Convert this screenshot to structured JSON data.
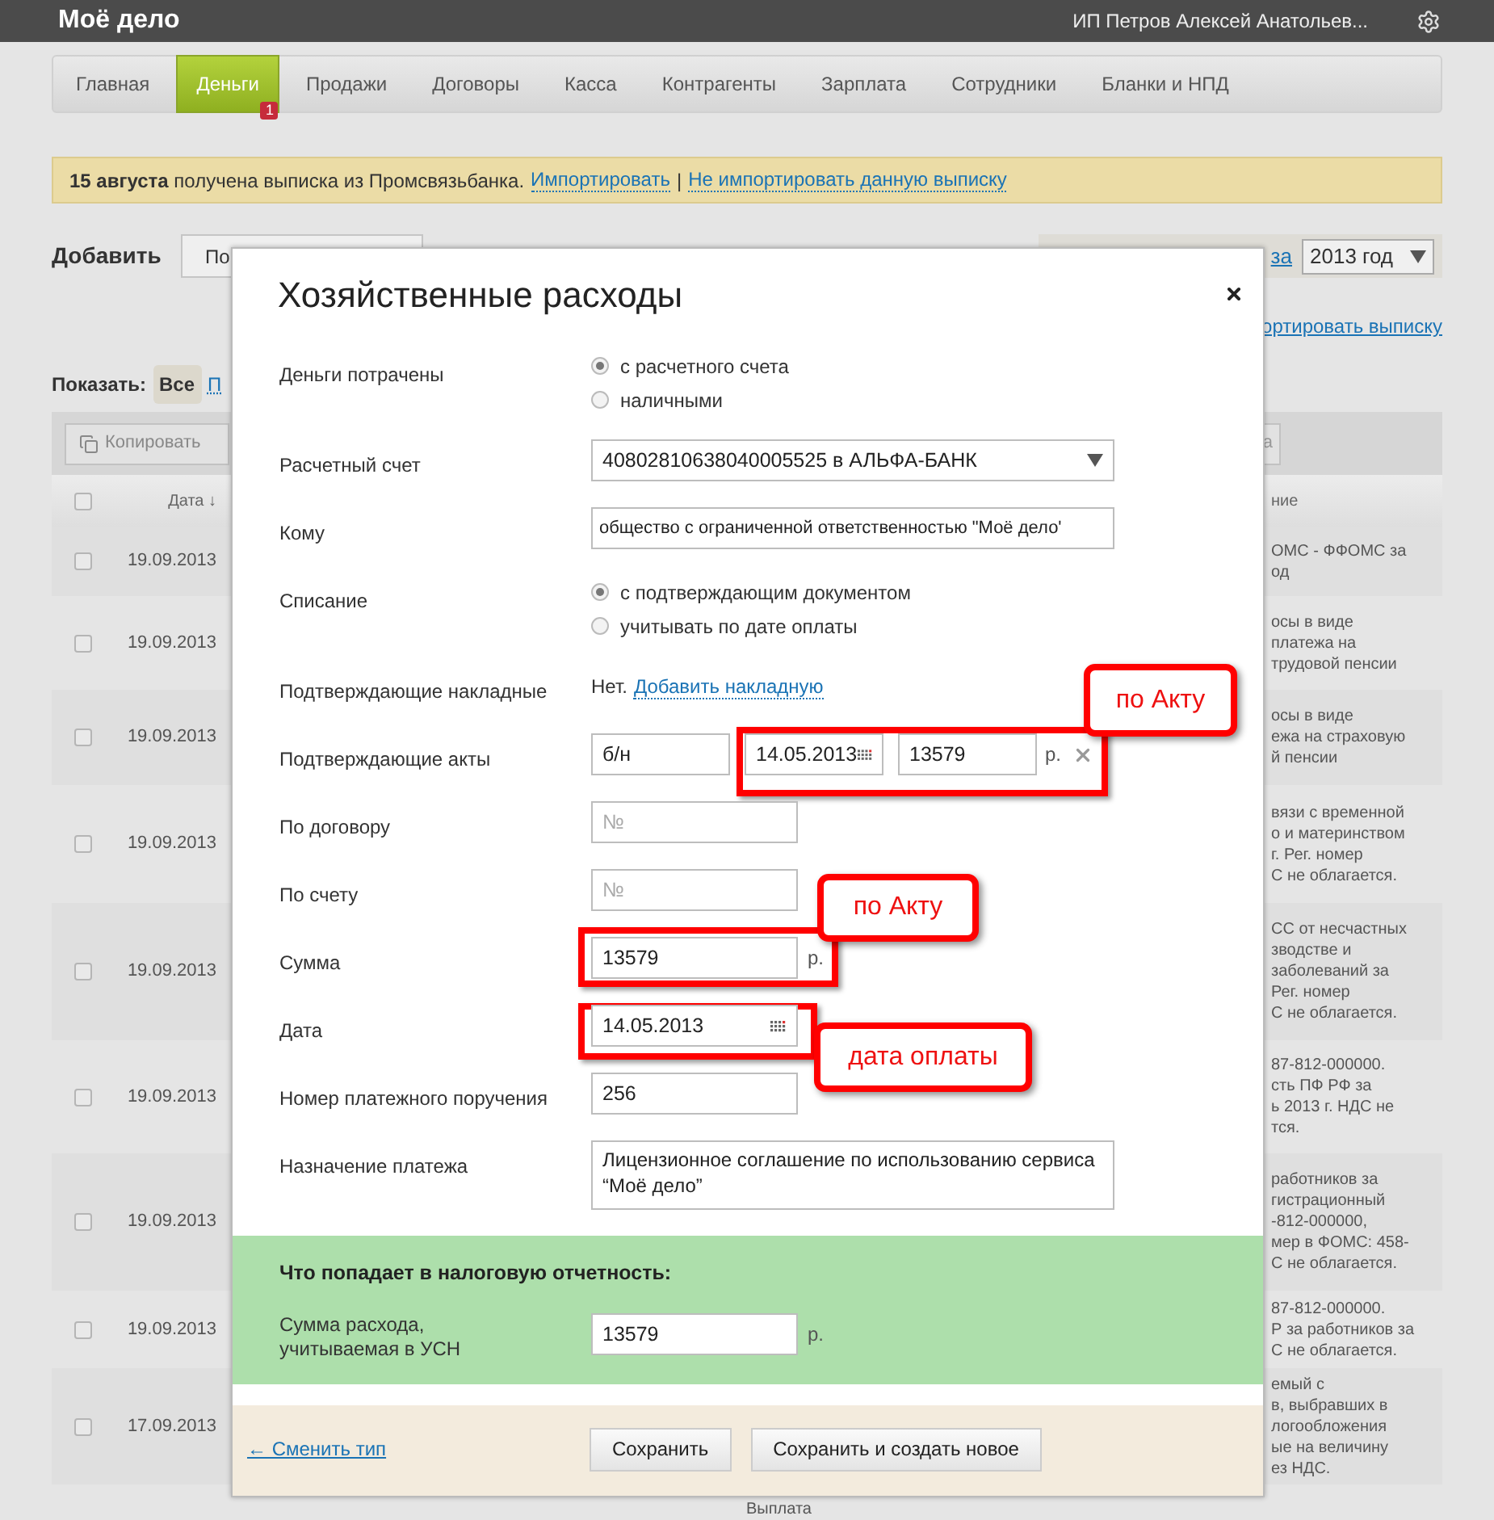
{
  "topbar": {
    "logo": "Моё дело",
    "user": "ИП Петров Алексей Анатольев..."
  },
  "nav": [
    {
      "label": "Главная",
      "selected": false
    },
    {
      "label": "Деньги",
      "selected": true,
      "badge": "1"
    },
    {
      "label": "Продажи",
      "selected": false
    },
    {
      "label": "Договоры",
      "selected": false
    },
    {
      "label": "Касса",
      "selected": false
    },
    {
      "label": "Контрагенты",
      "selected": false
    },
    {
      "label": "Зарплата",
      "selected": false
    },
    {
      "label": "Сотрудники",
      "selected": false
    },
    {
      "label": "Бланки и НПД",
      "selected": false
    }
  ],
  "notice": {
    "text": "**15 августа** получена выписка из Промсвязьбанка.",
    "links": [
      "Импортировать",
      "Не импортировать данную выписку"
    ],
    "separator": "|"
  },
  "add_row": {
    "label": "Добавить",
    "first_button": "По",
    "period_link": "за",
    "year": "2013 год",
    "import_link": "ортировать выписку"
  },
  "filter": {
    "label": "Показать:",
    "chips": [
      {
        "label": "Все",
        "selected": true
      },
      {
        "label": "П",
        "selected": false
      }
    ]
  },
  "table": {
    "all_checked": false,
    "copy_button": "Копировать",
    "right_button": "а",
    "columns": [
      "Дата ↓",
      "ние"
    ],
    "rows": [
      {
        "date": "19.09.2013",
        "checked": false,
        "lines": [
          "ОМС - ФФОМС за",
          "од"
        ]
      },
      {
        "date": "19.09.2013",
        "checked": false,
        "lines": [
          "осы в виде",
          "платежа на",
          "трудовой пенсии"
        ]
      },
      {
        "date": "19.09.2013",
        "checked": false,
        "lines": [
          "осы в виде",
          "ежа на страховую",
          "й пенсии"
        ]
      },
      {
        "date": "19.09.2013",
        "checked": false,
        "lines": [
          "вязи с временной",
          "о и материнством",
          "г. Рег. номер",
          "С не облагается."
        ]
      },
      {
        "date": "19.09.2013",
        "checked": false,
        "lines": [
          "СС от несчастных",
          "зводстве и",
          "заболеваний за",
          "Рег. номер",
          "С не облагается."
        ]
      },
      {
        "date": "19.09.2013",
        "checked": false,
        "lines": [
          "87-812-000000.",
          "сть ПФ РФ за",
          "ь 2013 г. НДС не",
          "тся."
        ]
      },
      {
        "date": "19.09.2013",
        "checked": false,
        "lines": [
          "работников за",
          "гистрационный",
          "-812-000000,",
          "мер в ФОМС: 458-",
          "С не облагается."
        ]
      },
      {
        "date": "19.09.2013",
        "checked": false,
        "lines": [
          "87-812-000000.",
          "Р за работников за",
          "С не облагается."
        ]
      },
      {
        "date": "17.09.2013",
        "checked": false,
        "lines": [
          "емый с",
          "в, выбравших в",
          "логообложения",
          "ые на величину",
          "ез НДС."
        ]
      }
    ],
    "below_text": "Выплата"
  },
  "modal": {
    "title": "Хозяйственные расходы",
    "rows": [
      {
        "kind": "radio",
        "label": "Деньги потрачены",
        "options": [
          {
            "label": "с расчетного счета",
            "selected": true
          },
          {
            "label": "наличными",
            "selected": false
          }
        ]
      },
      {
        "kind": "select",
        "label": "Расчетный счет",
        "value": "40802810638040005525 в АЛЬФА-БАНК"
      },
      {
        "kind": "text",
        "label": "Кому",
        "value": "общество с ограниченной ответственностью \"Моё дело'"
      },
      {
        "kind": "radio",
        "label": "Списание",
        "options": [
          {
            "label": "с подтверждающим документом",
            "selected": true
          },
          {
            "label": "учитывать по дате оплаты",
            "selected": false
          }
        ]
      },
      {
        "kind": "note",
        "label": "Подтверждающие накладные",
        "text": "Нет.",
        "link": "Добавить накладную"
      },
      {
        "kind": "acts",
        "label": "Подтверждающие акты",
        "number": "б/н",
        "date": "14.05.2013",
        "amount": "13579",
        "unit": "р."
      },
      {
        "kind": "short",
        "label": "По договору",
        "placeholder": "№"
      },
      {
        "kind": "short",
        "label": "По счету",
        "placeholder": "№"
      },
      {
        "kind": "short",
        "label": "Сумма",
        "value": "13579",
        "unit": "р."
      },
      {
        "kind": "date",
        "label": "Дата",
        "value": "14.05.2013"
      },
      {
        "kind": "short",
        "label": "Номер платежного поручения",
        "value": "256"
      },
      {
        "kind": "textarea",
        "label": "Назначение платежа",
        "value": "Лицензионное соглашение по использованию сервиса “Моё дело”"
      }
    ],
    "tax": {
      "title": "Что попадает в налоговую отчетность:",
      "label": "Сумма расхода, учитываемая в УСН",
      "value": "13579",
      "unit": "р."
    },
    "footer": {
      "back_link": "← Сменить тип",
      "buttons": [
        "Сохранить",
        "Сохранить и создать новое"
      ]
    }
  },
  "annotations": [
    {
      "text": "по Акту"
    },
    {
      "text": "по Акту"
    },
    {
      "text": "дата оплаты"
    }
  ]
}
